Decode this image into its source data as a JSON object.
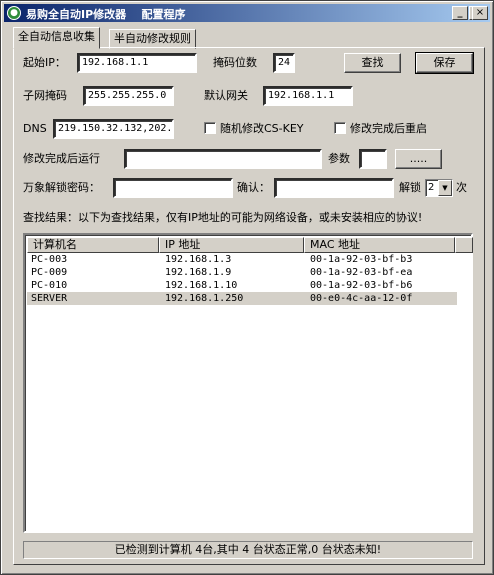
{
  "window": {
    "title": "易购全自动IP修改器    配置程序",
    "controls": {
      "minimize": "_",
      "maximize": "□",
      "close": "×"
    }
  },
  "tabs": [
    {
      "label": "全自动信息收集"
    },
    {
      "label": "半自动修改规则"
    }
  ],
  "form": {
    "start_ip_label": "起始IP：",
    "start_ip_value": "192.168.1.1",
    "mask_bits_label": "掩码位数",
    "mask_bits_value": "24",
    "find_button": "查找",
    "save_button": "保存",
    "subnet_label": "子网掩码",
    "subnet_value": "255.255.255.0",
    "gateway_label": "默认网关",
    "gateway_value": "192.168.1.1",
    "dns_label": "DNS",
    "dns_value": "219.150.32.132,202.",
    "random_cskey_label": "随机修改CS-KEY",
    "reboot_label": "修改完成后重启",
    "run_after_label": "修改完成后运行",
    "run_after_value": "",
    "params_label": "参数",
    "params_value": "",
    "browse_button": ".....",
    "unlock_pwd_label": "万象解锁密码：",
    "unlock_pwd_value": "",
    "confirm_label": "确认：",
    "confirm_value": "",
    "unlock_times_label": "解锁",
    "unlock_times_value": "2",
    "unlock_times_suffix": "次"
  },
  "results": {
    "caption": "查找结果：以下为查找结果，仅有IP地址的可能为网络设备，或未安装相应的协议!",
    "columns": [
      "计算机名",
      "IP 地址",
      "MAC 地址"
    ],
    "rows": [
      {
        "name": "PC-003",
        "ip": "192.168.1.3",
        "mac": "00-1a-92-03-bf-b3",
        "selected": false
      },
      {
        "name": "PC-009",
        "ip": "192.168.1.9",
        "mac": "00-1a-92-03-bf-ea",
        "selected": false
      },
      {
        "name": "PC-010",
        "ip": "192.168.1.10",
        "mac": "00-1a-92-03-bf-b6",
        "selected": false
      },
      {
        "name": "SERVER",
        "ip": "192.168.1.250",
        "mac": "00-e0-4c-aa-12-0f",
        "selected": true
      }
    ]
  },
  "status": {
    "text": "已检测到计算机 4台,其中 4 台状态正常,0 台状态未知!"
  },
  "colors": {
    "titlebar_start": "#0a246a",
    "titlebar_end": "#a6caf0",
    "face": "#d4d0c8"
  }
}
